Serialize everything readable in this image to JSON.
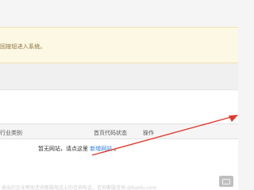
{
  "notice": {
    "text": "回按钮进入系统。"
  },
  "table": {
    "headers": {
      "industry": "行业类别",
      "code_status": "首页代码状态",
      "action": "操作"
    },
    "empty_prefix": "暂无网站，请点这里",
    "add_link": "新增网站",
    "empty_suffix": "。"
  },
  "footer": {
    "text": "·退出的企业帮助咨询客服电话上的咨询电话，咨询客服咨询 @baidu.com"
  },
  "colors": {
    "notice_bg": "#fcf8e3",
    "link": "#2a7ae2",
    "annotation_arrow": "#e03a2f"
  },
  "icons": {
    "corner_watermark": "watermark-icon"
  }
}
